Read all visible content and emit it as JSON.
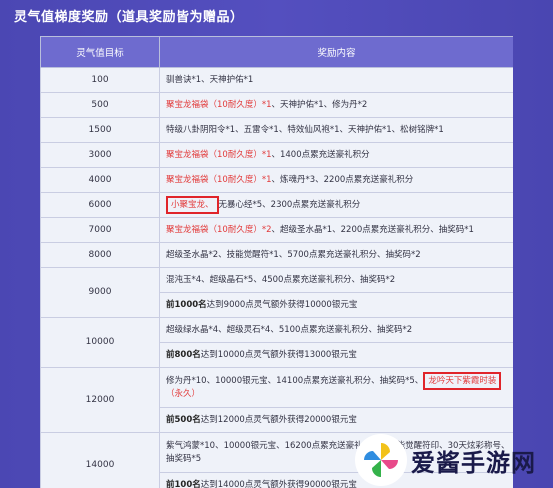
{
  "title": "灵气值梯度奖励（道具奖励皆为赠品）",
  "table": {
    "headers": [
      "灵气值目标",
      "奖励内容"
    ],
    "rows": [
      {
        "target": "100",
        "text": "驯兽诀*1、天神护佑*1"
      },
      {
        "target": "500",
        "red": "聚宝龙福袋（10耐久度）*1",
        "text": "、天神护佑*1、修为丹*2"
      },
      {
        "target": "1500",
        "text": "特级八卦阴阳令*1、五雷令*1、特效仙风袍*1、天神护佑*1、松树铭牌*1"
      },
      {
        "target": "3000",
        "red": "聚宝龙福袋（10耐久度）*1",
        "text": "、1400点累充送豪礼积分"
      },
      {
        "target": "4000",
        "red": "聚宝龙福袋（10耐久度）*1",
        "text": "、炼魂丹*3、2200点累充送豪礼积分"
      },
      {
        "target": "6000",
        "boxed": "小聚宝龙、",
        "text": "无暴心经*5、2300点累充送豪礼积分"
      },
      {
        "target": "7000",
        "red": "聚宝龙福袋（10耐久度）*2",
        "text": "、超级圣水晶*1、2200点累充送豪礼积分、抽奖码*1"
      },
      {
        "target": "8000",
        "text": "超级圣水晶*2、技能觉醒符*1、5700点累充送豪礼积分、抽奖码*2"
      }
    ],
    "row9000": {
      "target": "9000",
      "a": "混沌玉*4、超级晶石*5、4500点累充送豪礼积分、抽奖码*2",
      "b_bold": "前1000名",
      "b": "达到9000点灵气额外获得10000银元宝"
    },
    "row10000": {
      "target": "10000",
      "a": "超级绿水晶*4、超级灵石*4、5100点累充送豪礼积分、抽奖码*2",
      "b_bold": "前800名",
      "b": "达到10000点灵气额外获得13000银元宝"
    },
    "row12000": {
      "target": "12000",
      "a": "修为丹*10、10000银元宝、14100点累充送豪礼积分、抽奖码*5、",
      "a_box": "龙吟天下紫霞时装",
      "a_red": "（永久）",
      "b_bold": "前500名",
      "b": "达到12000点灵气额外获得20000银元宝"
    },
    "row14000": {
      "target": "14000",
      "a": "紫气鸿蒙*10、10000银元宝、16200点累充送豪礼积分、技能觉醒符印、30天炫彩称号、抽奖码*5",
      "b_bold": "前100名",
      "b": "达到14000点灵气额外获得90000银元宝"
    }
  },
  "watermark": {
    "text": "爱酱手游网"
  },
  "colors": {
    "accent_red": "#e23a3a",
    "header_bg": "#6e6bcf",
    "page_bg": "#4f4bb8"
  }
}
